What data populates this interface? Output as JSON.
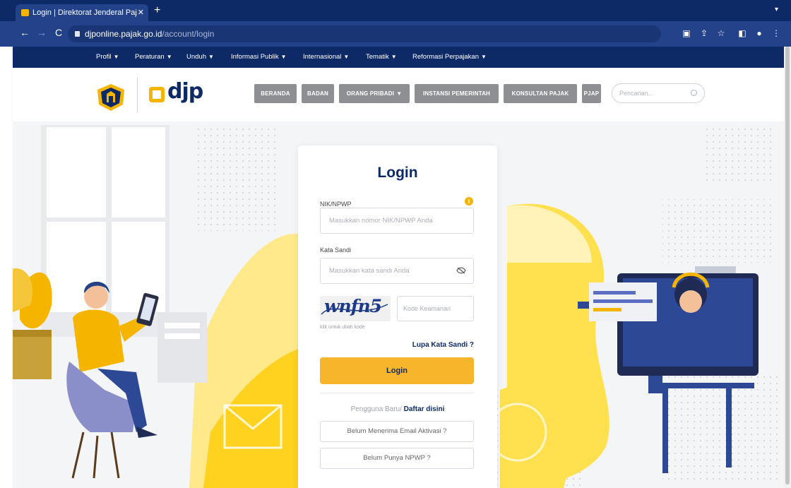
{
  "browser": {
    "tab_title": "Login | Direktorat Jenderal Paj",
    "url_host": "djponline.pajak.go.id",
    "url_path": "/account/login"
  },
  "site_menu": [
    {
      "label": "Profil"
    },
    {
      "label": "Peraturan"
    },
    {
      "label": "Unduh"
    },
    {
      "label": "Informasi Publik"
    },
    {
      "label": "Internasional"
    },
    {
      "label": "Tematik"
    },
    {
      "label": "Reformasi Perpajakan"
    }
  ],
  "header": {
    "logo_text": "djp",
    "nav": [
      {
        "label": "BERANDA"
      },
      {
        "label": "BADAN"
      },
      {
        "label": "ORANG PRIBADI"
      },
      {
        "label": "INSTANSI PEMERINTAH"
      },
      {
        "label": "KONSULTAN PAJAK"
      },
      {
        "label": "PJAP"
      }
    ],
    "search_placeholder": "Pencarian..."
  },
  "login": {
    "title": "Login",
    "nik_label": "NIK/NPWP",
    "nik_placeholder": "Masukkan nomor NIK/NPWP Anda",
    "password_label": "Kata Sandi",
    "password_placeholder": "Masukkan kata sandi Anda",
    "captcha_text": "wnfn5",
    "captcha_placeholder": "Kode Keamanan",
    "captcha_hint": "klik untuk ubah kode",
    "forgot_label": "Lupa Kata Sandi ?",
    "login_button": "Login",
    "new_user_text": "Pengguna Baru/",
    "register_link": "Daftar disini",
    "activation_button": "Belum Menerima Email Aktivasi ?",
    "npwp_button": "Belum Punya NPWP ?"
  },
  "colors": {
    "navy": "#0e2a66",
    "accent_yellow": "#f5b400",
    "nav_grey": "#8d8f93"
  }
}
